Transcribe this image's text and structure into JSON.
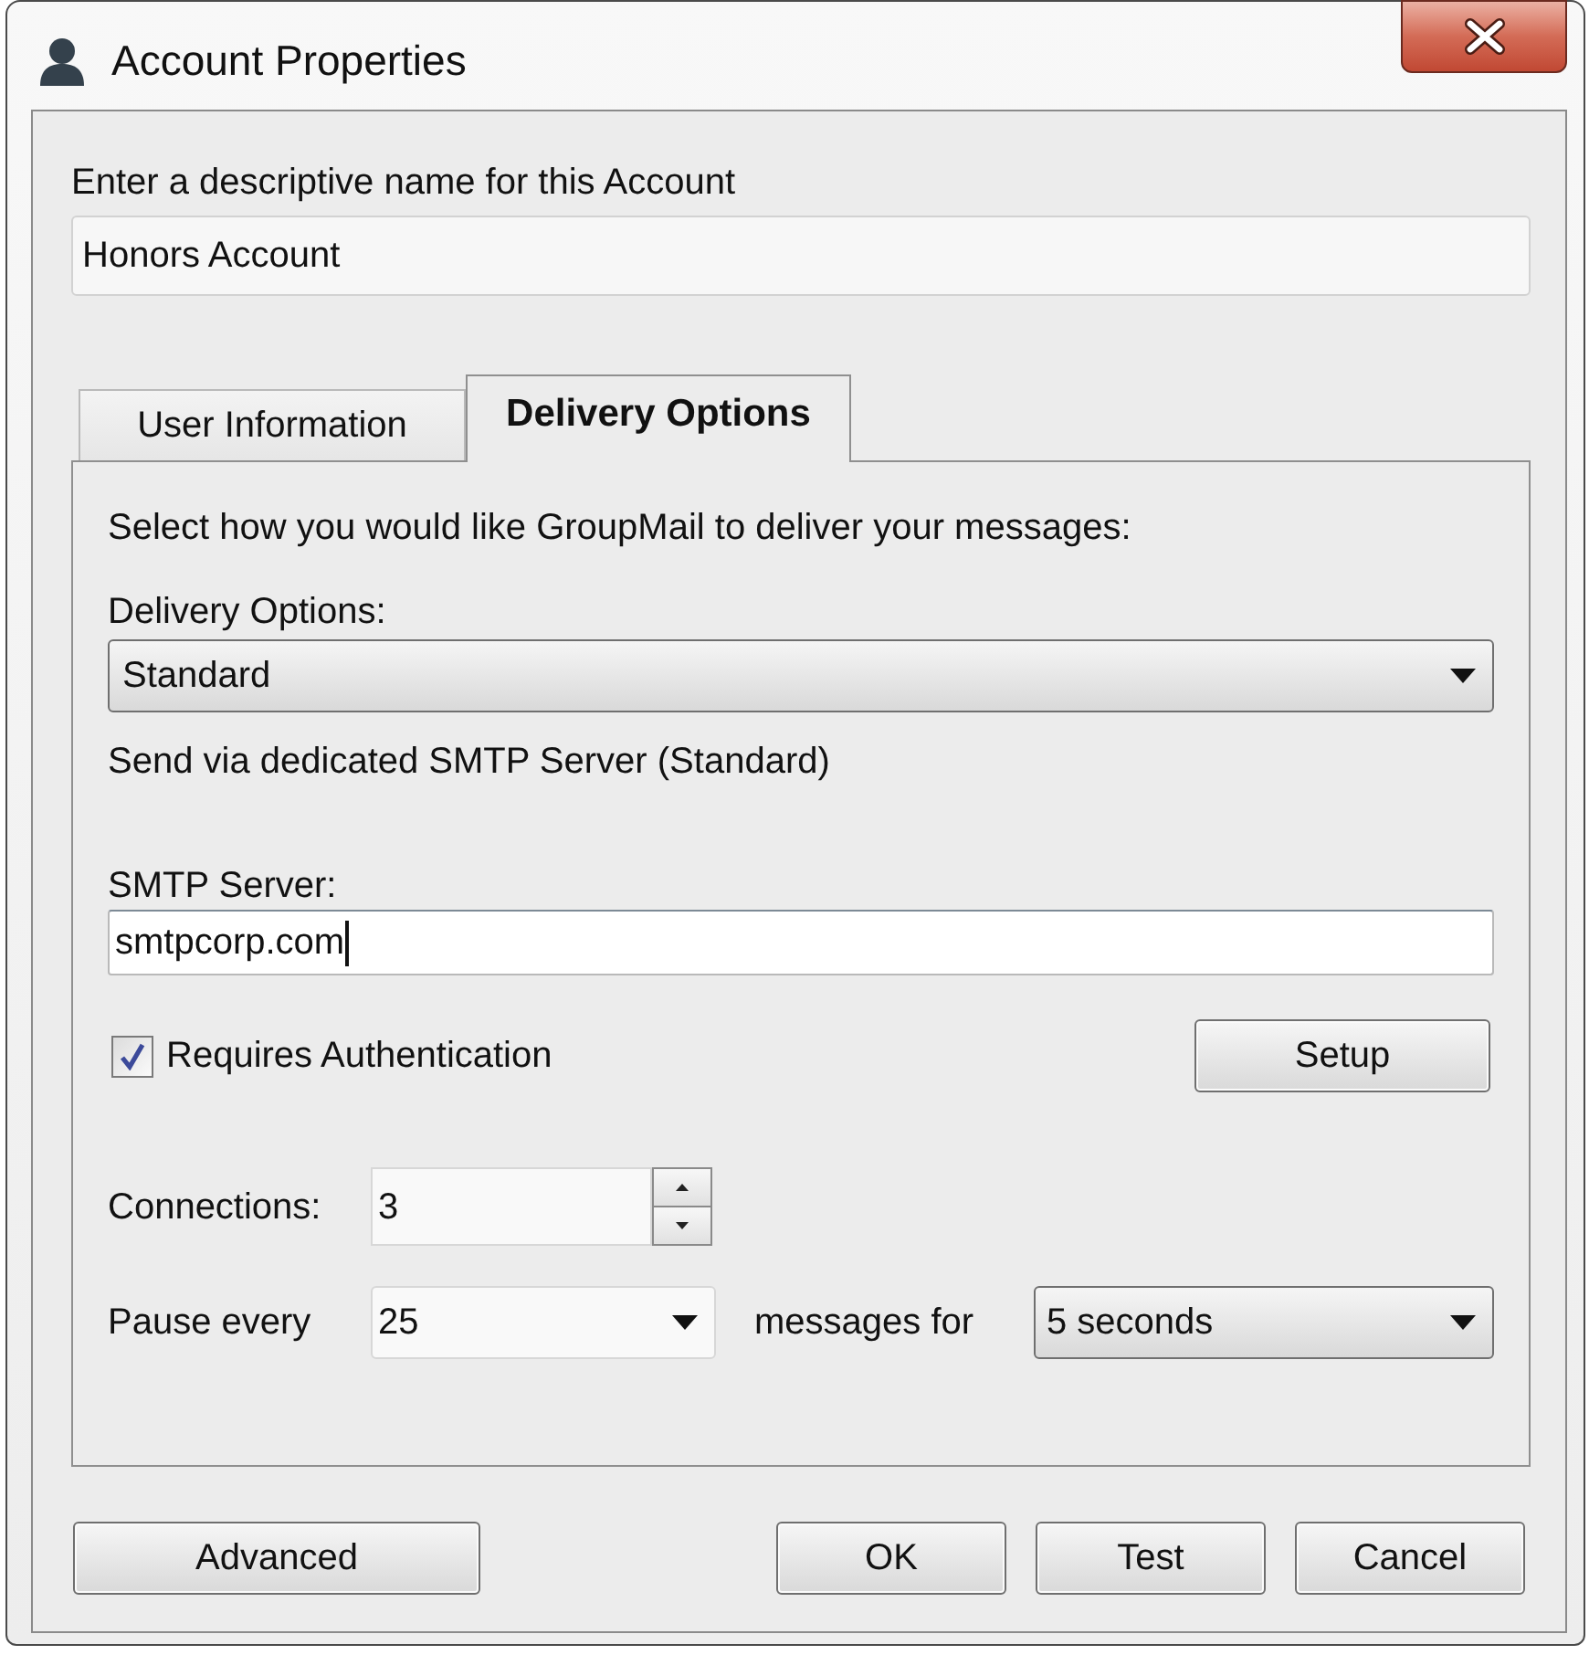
{
  "window": {
    "title": "Account Properties"
  },
  "account_name": {
    "label": "Enter a descriptive name for this Account",
    "value": "Honors Account"
  },
  "tabs": [
    {
      "label": "User Information",
      "selected": false
    },
    {
      "label": "Delivery Options",
      "selected": true
    }
  ],
  "delivery_panel": {
    "intro": "Select how you would like GroupMail to deliver your messages:",
    "delivery_options": {
      "label": "Delivery Options:",
      "value": "Standard"
    },
    "description": "Send via dedicated SMTP Server (Standard)",
    "smtp_server": {
      "label": "SMTP Server:",
      "value": "smtpcorp.com",
      "focused": true
    },
    "authentication": {
      "label": "Requires Authentication",
      "checked": true
    },
    "setup_button": {
      "label": "Setup"
    },
    "connections": {
      "label": "Connections:",
      "value": "3"
    },
    "pause": {
      "label": "Pause every",
      "count": "25",
      "middle_label": "messages for",
      "duration": "5 seconds"
    }
  },
  "buttons": [
    {
      "label": "Advanced",
      "kind": "left"
    },
    {
      "label": "OK",
      "kind": "right"
    },
    {
      "label": "Test",
      "kind": "right"
    },
    {
      "label": "Cancel",
      "kind": "right"
    }
  ]
}
